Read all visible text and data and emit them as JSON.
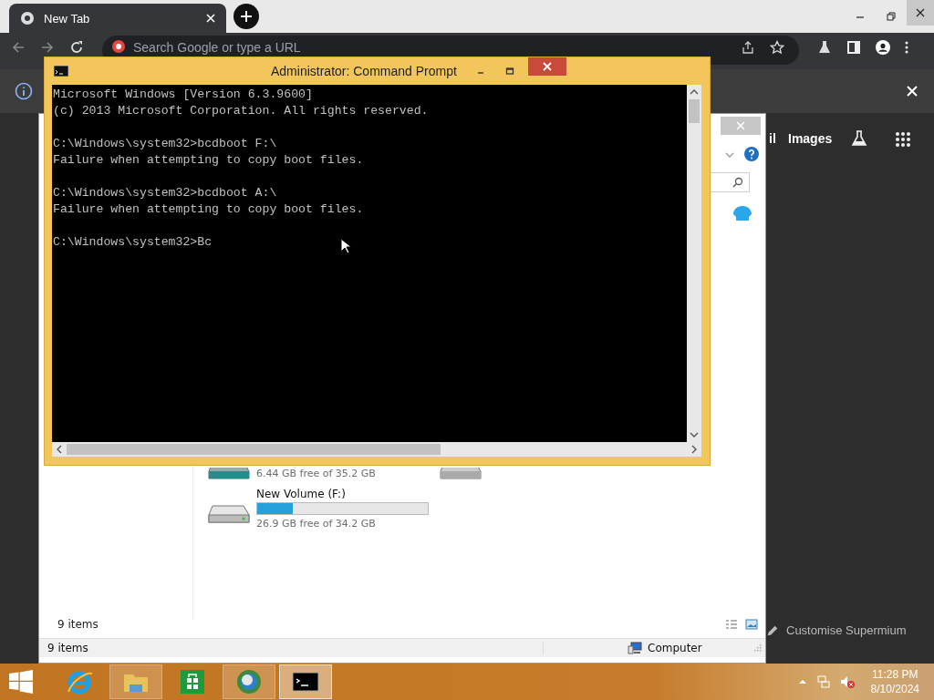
{
  "browser": {
    "tab": {
      "title": "New Tab",
      "selected": true
    },
    "omnibox": {
      "placeholder": "Search Google or type a URL"
    },
    "page": {
      "links": [
        "il",
        "Images"
      ],
      "customise": "Customise Supermium"
    }
  },
  "explorer": {
    "drives": [
      {
        "free": "6.44 GB free of 35.2 GB"
      },
      {
        "label": "New Volume (F:)",
        "level": 0.21,
        "free": "26.9 GB free of 34.2 GB"
      }
    ],
    "item_count": "9 items",
    "status_bar": {
      "items": "9 items",
      "location": "Computer"
    }
  },
  "cmd": {
    "title": "Administrator: Command Prompt",
    "blocks": [
      [
        "Microsoft Windows [Version 6.3.9600]",
        "(c) 2013 Microsoft Corporation. All rights reserved."
      ],
      [
        "C:\\Windows\\system32>bcdboot F:\\",
        "Failure when attempting to copy boot files."
      ],
      [
        "C:\\Windows\\system32>bcdboot A:\\",
        "Failure when attempting to copy boot files."
      ],
      [
        "C:\\Windows\\system32>Bc"
      ]
    ]
  },
  "taskbar": {
    "apps": [
      {
        "kind": "ie",
        "running": false,
        "selected": false
      },
      {
        "kind": "folder",
        "running": true,
        "selected": false
      },
      {
        "kind": "store",
        "running": false,
        "selected": false
      },
      {
        "kind": "globe",
        "running": true,
        "selected": false
      },
      {
        "kind": "console",
        "running": true,
        "selected": true
      }
    ],
    "time": "11:28 PM",
    "date": "8/10/2024"
  }
}
